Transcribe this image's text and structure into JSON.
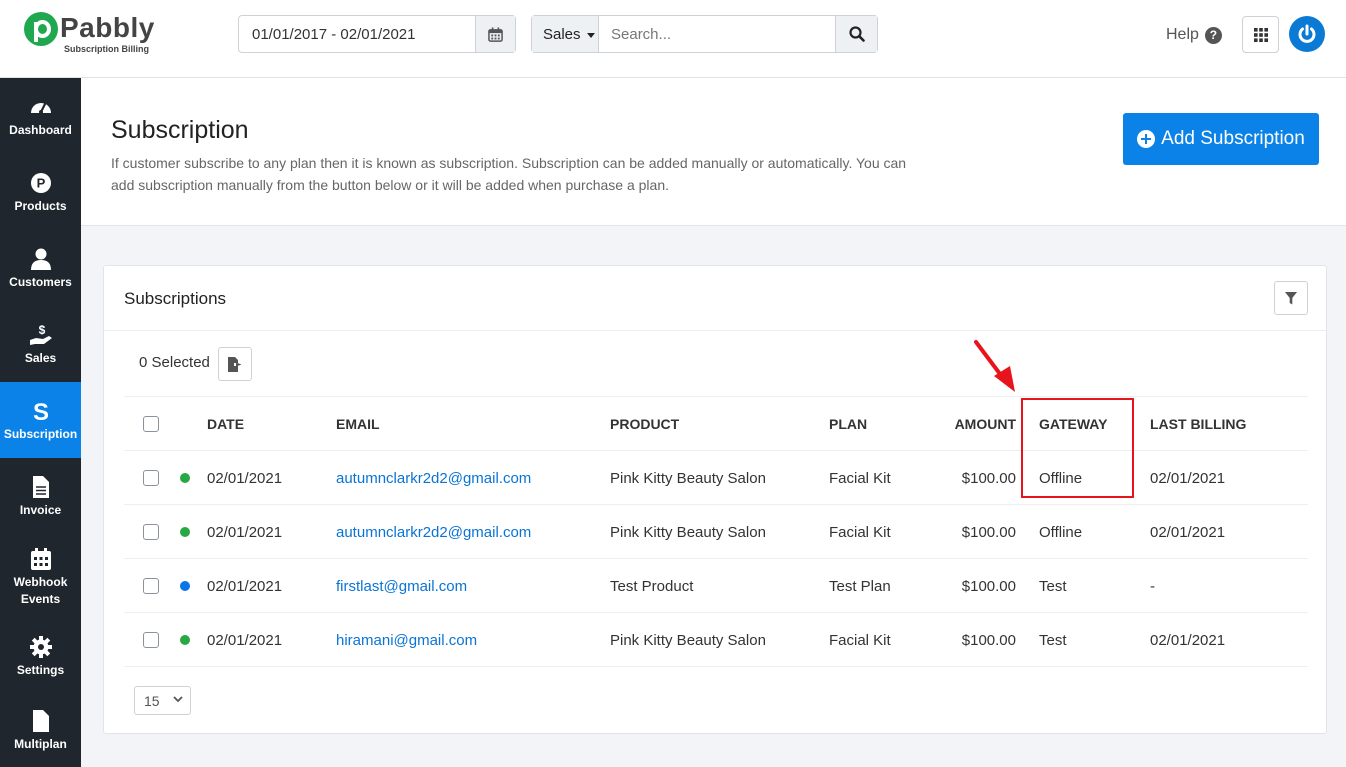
{
  "brand": {
    "name": "Pabbly",
    "subtitle": "Subscription Billing",
    "color": "#1fa84f"
  },
  "topbar": {
    "date_range": "01/01/2017 - 02/01/2021",
    "search_scope": "Sales",
    "search_placeholder": "Search...",
    "help_label": "Help"
  },
  "sidebar": {
    "items": [
      {
        "label": "Dashboard",
        "icon": "gauge-icon"
      },
      {
        "label": "Products",
        "icon": "p-circle-icon"
      },
      {
        "label": "Customers",
        "icon": "user-icon"
      },
      {
        "label": "Sales",
        "icon": "hand-coin-icon"
      },
      {
        "label": "Subscription",
        "icon": "s-icon",
        "active": true
      },
      {
        "label": "Invoice",
        "icon": "file-icon"
      },
      {
        "label": "Webhook Events",
        "icon": "calendar-icon"
      },
      {
        "label": "Settings",
        "icon": "gear-icon"
      },
      {
        "label": "Multiplan",
        "icon": "file-icon"
      }
    ]
  },
  "header": {
    "title": "Subscription",
    "description": "If customer subscribe to any plan then it is known as subscription. Subscription can be added manually or automatically. You can add subscription manually from the button below or it will be added when purchase a plan.",
    "add_button": "Add Subscription"
  },
  "card": {
    "title": "Subscriptions",
    "selected_label": "0 Selected",
    "page_size": "15"
  },
  "table": {
    "columns": [
      "DATE",
      "EMAIL",
      "PRODUCT",
      "PLAN",
      "AMOUNT",
      "GATEWAY",
      "LAST BILLING"
    ],
    "rows": [
      {
        "status_color": "#28a745",
        "date": "02/01/2021",
        "email": "autumnclarkr2d2@gmail.com",
        "product": "Pink Kitty Beauty Salon",
        "plan": "Facial Kit",
        "amount": "$100.00",
        "gateway": "Offline",
        "last_billing": "02/01/2021"
      },
      {
        "status_color": "#28a745",
        "date": "02/01/2021",
        "email": "autumnclarkr2d2@gmail.com",
        "product": "Pink Kitty Beauty Salon",
        "plan": "Facial Kit",
        "amount": "$100.00",
        "gateway": "Offline",
        "last_billing": "02/01/2021"
      },
      {
        "status_color": "#0a74e8",
        "date": "02/01/2021",
        "email": "firstlast@gmail.com",
        "product": "Test Product",
        "plan": "Test Plan",
        "amount": "$100.00",
        "gateway": "Test",
        "last_billing": "-"
      },
      {
        "status_color": "#28a745",
        "date": "02/01/2021",
        "email": "hiramani@gmail.com",
        "product": "Pink Kitty Beauty Salon",
        "plan": "Facial Kit",
        "amount": "$100.00",
        "gateway": "Test",
        "last_billing": "02/01/2021"
      }
    ]
  },
  "colors": {
    "accent": "#0a82e8",
    "sidebar_bg": "#20262d",
    "annotation": "#e8141b"
  }
}
